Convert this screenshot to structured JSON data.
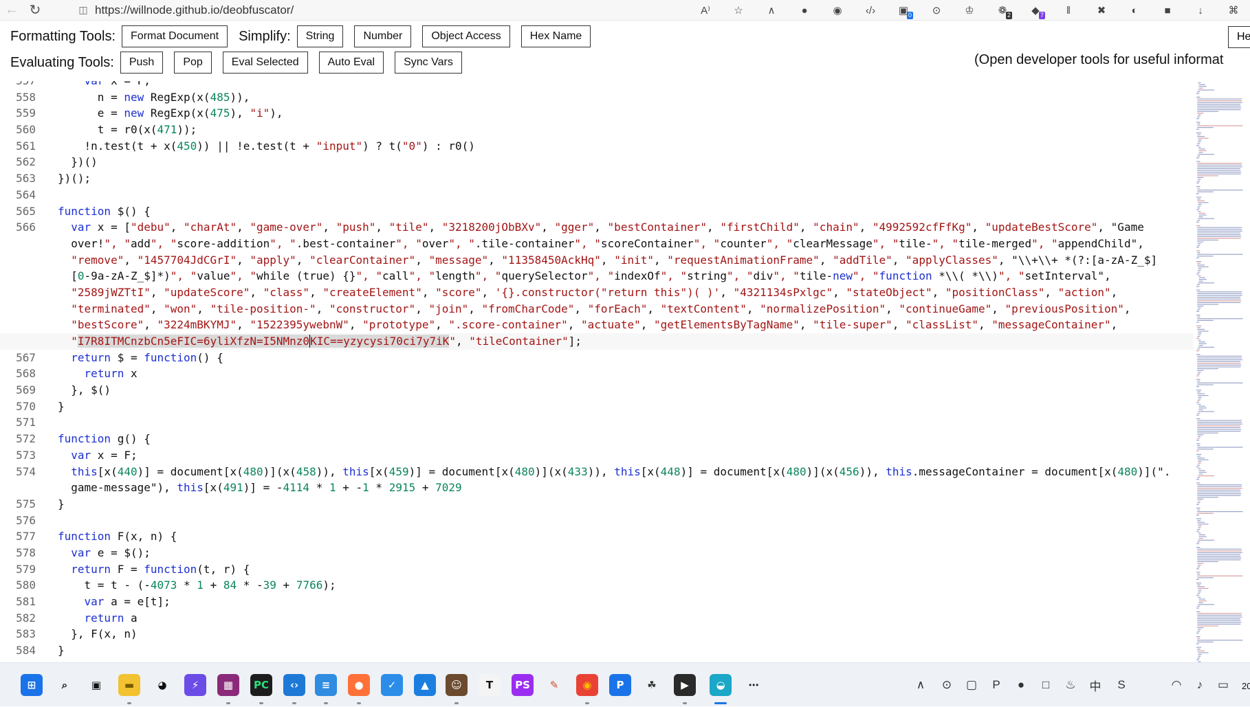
{
  "browser": {
    "url": "https://willnode.github.io/deobfuscator/",
    "extensions": [
      {
        "icon": "read-aloud-icon",
        "glyph": "A⁾"
      },
      {
        "icon": "favorite-star-icon",
        "glyph": "☆"
      },
      {
        "icon": "ext-gray-icon",
        "glyph": "∧"
      },
      {
        "icon": "ext-ring-icon",
        "glyph": "●"
      },
      {
        "icon": "cookie-icon",
        "glyph": "◉"
      },
      {
        "icon": "devtools-icon",
        "glyph": "‹/›"
      },
      {
        "icon": "ext-blue-icon",
        "glyph": "▣",
        "badge": "0",
        "badge_style": ""
      },
      {
        "icon": "ext-hat-icon",
        "glyph": "⊙"
      },
      {
        "icon": "ext-light-icon",
        "glyph": "♔"
      },
      {
        "icon": "ext-red-icon",
        "glyph": "❁",
        "badge": "2",
        "badge_style": "dark"
      },
      {
        "icon": "ext-cube-icon",
        "glyph": "◆",
        "badge": "7",
        "badge_style": "purple"
      },
      {
        "icon": "ext-bars-icon",
        "glyph": "‖"
      },
      {
        "icon": "ext-x-icon",
        "glyph": "✖"
      },
      {
        "icon": "ext-eye-icon",
        "glyph": "◐"
      },
      {
        "icon": "ext-panda-icon",
        "glyph": "■"
      },
      {
        "icon": "download-icon",
        "glyph": "↓"
      },
      {
        "icon": "extensions-puzzle-icon",
        "glyph": "⌘"
      }
    ]
  },
  "toolbar": {
    "formatting_label": "Formatting Tools:",
    "format_document": "Format Document",
    "simplify_label": "Simplify:",
    "string": "String",
    "number": "Number",
    "object_access": "Object Access",
    "hex_name": "Hex Name",
    "help_partial": "He",
    "evaluating_label": "Evaluating Tools:",
    "push": "Push",
    "pop": "Pop",
    "eval_selected": "Eval Selected",
    "auto_eval": "Auto Eval",
    "sync_vars": "Sync Vars",
    "hint": "(Open developer tools for useful informat"
  },
  "code_lines": [
    {
      "n": "557",
      "t": "    var x = F;"
    },
    {
      "n": "558",
      "t": "      n = new RegExp(x(485)),"
    },
    {
      "n": "559",
      "t": "      e = new RegExp(x(475), \"i\"),"
    },
    {
      "n": "560",
      "t": "      t = r0(x(471));"
    },
    {
      "n": "561",
      "t": "    !n.test(t + x(450)) || !e.test(t + \"input\") ? t(\"0\") : r0()"
    },
    {
      "n": "562",
      "t": "  })()"
    },
    {
      "n": "563",
      "t": "})();"
    },
    {
      "n": "564",
      "t": ""
    },
    {
      "n": "565",
      "t": "function $() {"
    },
    {
      "n": "566",
      "t": "  var x = [\"debu\", \"charAt\", \"game-over\", \"push\", \"tile\", \"3218200jObBXv\", \"gger\", \"bestContainer\", \"firstChild\", \"chain\", \"4992592cfFfKg\", \"updateBestScore\", \"Game"
    },
    {
      "n": "",
      "t": "  over!\", \"add\", \"score-addition\", \".best-container\", \"over\", \".tile-container\", \"scoreContainer\", \"counter\", \"clearMessage\", \"tile-\", \"tile-merged\", \"appendChild\","
    },
    {
      "n": "",
      "t": "  \"remove\", \"1457704JdCGrI\", \"apply\", \"clearContainer\", \"message\", \"11358450AckHq\", \"init\", \"requestAnimationFrame\", \"addTile\", \"applyClasses\", \"\\\\+\\\\+ *(?:[a-zA-Z_$]"
    },
    {
      "n": "",
      "t": "  [0-9a-zA-Z_$]*)\", \"value\", \"while (true) {}\", \"call\", \"length\", \"querySelector\", \"indexOf\", \"string\", \"div\", \"tile-new\", \"function *\\\\( *\\\\)\", \"setInterval\","
    },
    {
      "n": "",
      "t": "  \"2589jWZTtI\", \"updateScore\", \"class\", \"createElement\", \"score\", '{}.constructor(\"return this\")( )', \"4321134sPxlgc\", \"stateObject\", \"positionClass\", \"action\","
    },
    {
      "n": "",
      "t": "  \"terminated\", \"won\", \"tile-position-\", \"constructor\", \"join\", \"fromCharCode\", \"forEach\", \"textContent\", \"normalizePosition\", \"continueGame\", \"previousPosition\","
    },
    {
      "n": "",
      "t": "  \"bestScore\", \"3224mBKYMJ\", \"1522395ywebnW\", \"prototype\", \".score-container\", \"actuate\", \"getElementsByTagName\", \"tile-super\", \"classList\", \"messageContainer\","
    },
    {
      "n": "",
      "t": "  \"I7R8ITMCnzbCn5eFIC=6yliXfzN=I5NMnz0KIC==yzycysi70ci7y7iK\", \"tileContainer\"];"
    },
    {
      "n": "567",
      "t": "  return $ = function() {"
    },
    {
      "n": "568",
      "t": "    return x"
    },
    {
      "n": "569",
      "t": "  }, $()"
    },
    {
      "n": "570",
      "t": "}"
    },
    {
      "n": "571",
      "t": ""
    },
    {
      "n": "572",
      "t": "function g() {"
    },
    {
      "n": "573",
      "t": "  var x = F;"
    },
    {
      "n": "574",
      "t": "  this[x(440)] = document[x(480)](x(458)), this[x(459)] = document[x(480)](x(433)), this[x(448)] = document[x(480)](x(456)), this.messageContainer = document[x(480)](\"."
    },
    {
      "n": "",
      "t": "  game-message\"), this[x(491)] = -4114 * 1 + -1 * 2915 + 7029"
    },
    {
      "n": "575",
      "t": "}"
    },
    {
      "n": "576",
      "t": ""
    },
    {
      "n": "577",
      "t": "function F(x, n) {"
    },
    {
      "n": "578",
      "t": "  var e = $();"
    },
    {
      "n": "579",
      "t": "  return F = function(t, r) {"
    },
    {
      "n": "580",
      "t": "    t = t - (-4073 * 1 + 84 * -39 + 7766);"
    },
    {
      "n": "581",
      "t": "    var a = e[t];"
    },
    {
      "n": "582",
      "t": "    return a"
    },
    {
      "n": "583",
      "t": "  }, F(x, n)"
    },
    {
      "n": "584",
      "t": "}"
    }
  ],
  "taskbar": {
    "apps": [
      {
        "icon": "windows-start-icon",
        "glyph": "⊞",
        "color": "#1a73e8",
        "text_color": "#fff"
      },
      {
        "icon": "search-icon",
        "glyph": "⌕",
        "color": "transparent",
        "text_color": "#111"
      },
      {
        "icon": "task-view-icon",
        "glyph": "▣",
        "color": "transparent",
        "text_color": "#111"
      },
      {
        "icon": "file-explorer-icon",
        "glyph": "▬",
        "color": "#f2c230",
        "text_color": "#7a5a00"
      },
      {
        "icon": "qq-penguin-icon",
        "glyph": "◕",
        "color": "transparent",
        "text_color": "#111"
      },
      {
        "icon": "app-purple-icon",
        "glyph": "⚡",
        "color": "#6b4ce6",
        "text_color": "#fff"
      },
      {
        "icon": "winrar-icon",
        "glyph": "▦",
        "color": "#8b2a7a",
        "text_color": "#fff"
      },
      {
        "icon": "pycharm-icon",
        "glyph": "PC",
        "color": "#1d1d1d",
        "text_color": "#2ce07a"
      },
      {
        "icon": "vscode-icon",
        "glyph": "‹›",
        "color": "#1e78d6",
        "text_color": "#fff"
      },
      {
        "icon": "notepad-icon",
        "glyph": "≡",
        "color": "#2f8ce0",
        "text_color": "#fff"
      },
      {
        "icon": "firefox-icon",
        "glyph": "●",
        "color": "#ff7139",
        "text_color": "#fff"
      },
      {
        "icon": "app-check-icon",
        "glyph": "✓",
        "color": "#2b8de8",
        "text_color": "#fff"
      },
      {
        "icon": "photos-icon",
        "glyph": "▲",
        "color": "#1c7fe0",
        "text_color": "#fff"
      },
      {
        "icon": "app-avatar-icon",
        "glyph": "☺",
        "color": "#6b4a2e",
        "text_color": "#fff"
      },
      {
        "icon": "typora-icon",
        "glyph": "T",
        "color": "#f4f4f4",
        "text_color": "#111"
      },
      {
        "icon": "phpstorm-icon",
        "glyph": "PS",
        "color": "#9b2df0",
        "text_color": "#fff"
      },
      {
        "icon": "app-pen-icon",
        "glyph": "✎",
        "color": "transparent",
        "text_color": "#d04a2a"
      },
      {
        "icon": "chrome-icon",
        "glyph": "◉",
        "color": "#e94235",
        "text_color": "#fbbc04"
      },
      {
        "icon": "app-p-icon",
        "glyph": "P",
        "color": "#1a73e8",
        "text_color": "#fff"
      },
      {
        "icon": "app-cat-icon",
        "glyph": "☘",
        "color": "transparent",
        "text_color": "#333"
      },
      {
        "icon": "media-player-icon",
        "glyph": "▶",
        "color": "#2a2a2a",
        "text_color": "#fff"
      },
      {
        "icon": "edge-icon",
        "glyph": "◒",
        "color": "#1ba7c7",
        "text_color": "#fff"
      },
      {
        "icon": "more-apps-icon",
        "glyph": "⋯",
        "color": "transparent",
        "text_color": "#111"
      }
    ],
    "tray": [
      {
        "icon": "chevron-up-icon",
        "glyph": "∧"
      },
      {
        "icon": "tray-app-icon",
        "glyph": "⊙"
      },
      {
        "icon": "tray-monitor-icon",
        "glyph": "▢"
      },
      {
        "icon": "tray-p-icon",
        "glyph": "P"
      },
      {
        "icon": "wechat-icon",
        "glyph": "●"
      },
      {
        "icon": "tray-window-icon",
        "glyph": "□"
      },
      {
        "icon": "tray-flame-icon",
        "glyph": "♨"
      },
      {
        "icon": "ime-icon",
        "glyph": "中"
      },
      {
        "icon": "tray-s-icon",
        "glyph": "S"
      },
      {
        "icon": "wifi-icon",
        "glyph": "◠"
      },
      {
        "icon": "volume-icon",
        "glyph": "♪"
      },
      {
        "icon": "battery-icon",
        "glyph": "▭"
      }
    ],
    "clock_partial": "20"
  }
}
